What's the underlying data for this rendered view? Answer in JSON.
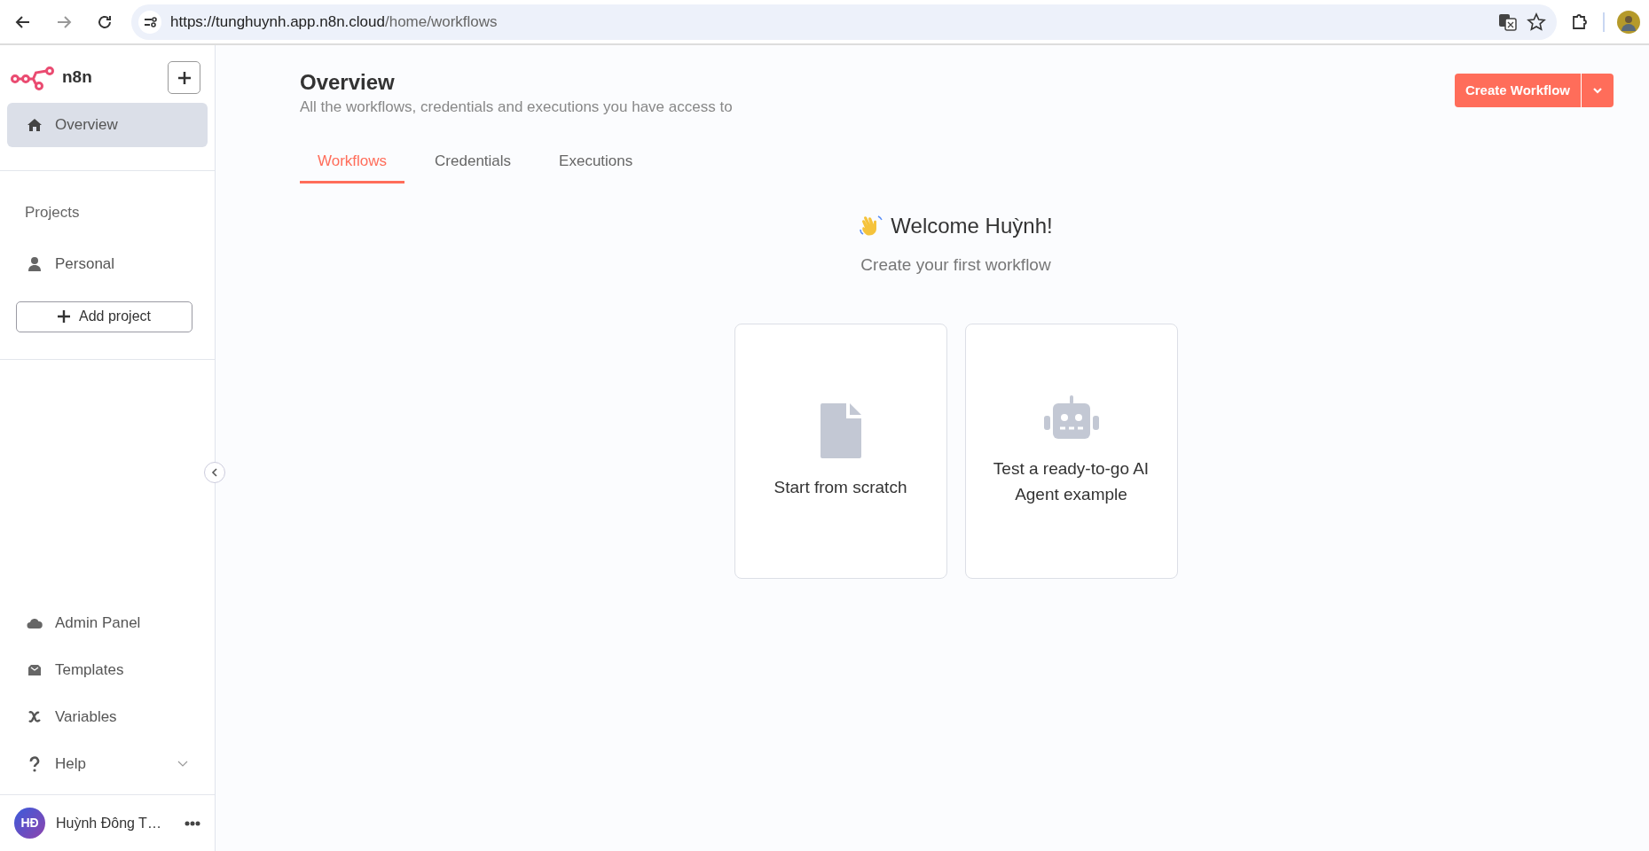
{
  "browser": {
    "url_host": "https://tunghuynh.app.n8n.cloud",
    "url_path": "/home/workflows"
  },
  "sidebar": {
    "logo": "n8n",
    "top_items": [
      {
        "label": "Overview",
        "selected": true
      }
    ],
    "projects_heading": "Projects",
    "projects": [
      {
        "label": "Personal",
        "selected": false
      }
    ],
    "add_project": "Add project",
    "bottom_items": [
      {
        "label": "Admin Panel"
      },
      {
        "label": "Templates"
      },
      {
        "label": "Variables"
      },
      {
        "label": "Help",
        "expanded": false
      }
    ],
    "user": {
      "initials": "HĐ",
      "name": "Huỳnh Đông T…"
    }
  },
  "main": {
    "title": "Overview",
    "subtitle": "All the workflows, credentials and executions you have access to",
    "create_button": "Create Workflow",
    "tabs": [
      {
        "label": "Workflows",
        "selected": true
      },
      {
        "label": "Credentials",
        "selected": false
      },
      {
        "label": "Executions",
        "selected": false
      }
    ],
    "welcome": "Welcome Huỳnh!",
    "welcome_subtitle": "Create your first workflow",
    "cards": [
      {
        "label": "Start from scratch"
      },
      {
        "label": "Test a ready-to-go AI Agent example"
      }
    ]
  }
}
